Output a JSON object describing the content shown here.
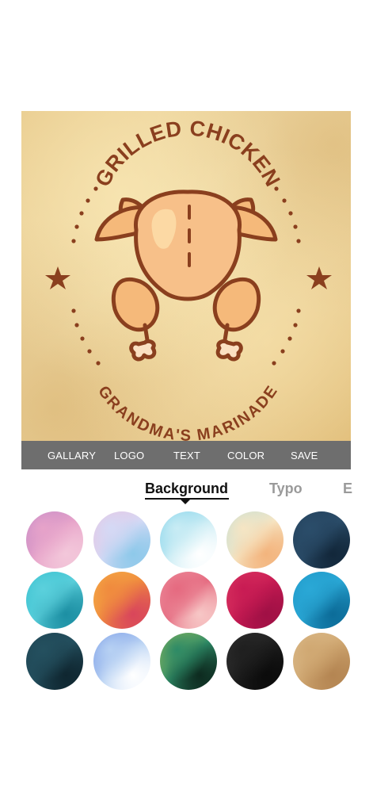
{
  "canvas": {
    "title": "GRILLED CHICKEN",
    "subtitle": "GRANDMA'S MARINADE"
  },
  "toolbar": {
    "items": [
      "GALLARY",
      "LOGO",
      "TEXT",
      "COLOR",
      "SAVE"
    ]
  },
  "tabs": {
    "items": [
      "Background",
      "Typo",
      "E"
    ],
    "active": "Background"
  },
  "colors": {
    "brand_brown": "#8a3f1e",
    "toolbar": "#6e6e6e",
    "chicken_skin": "#f5b97a"
  },
  "swatches": [
    {
      "name": "watercolor-purple-pink",
      "colors": [
        "#b07cc7",
        "#e7a3c9",
        "#f3c7da"
      ]
    },
    {
      "name": "watercolor-pastel-blue",
      "colors": [
        "#f4b9d6",
        "#d4d9f5",
        "#8ec9ea"
      ]
    },
    {
      "name": "watercolor-cyan-white",
      "colors": [
        "#5fc6e6",
        "#c9ecf4",
        "#ffffff"
      ]
    },
    {
      "name": "gradient-peach-teal",
      "colors": [
        "#a9dde1",
        "#f6e5c3",
        "#f3b47d"
      ]
    },
    {
      "name": "grunge-navy",
      "colors": [
        "#1f3a52",
        "#2b4d6a",
        "#12273a"
      ]
    },
    {
      "name": "watercolor-teal",
      "colors": [
        "#22b7c7",
        "#5bd0dc",
        "#1c8fa3"
      ]
    },
    {
      "name": "watercolor-orange-red",
      "colors": [
        "#f6c64a",
        "#f08a3e",
        "#d9465b"
      ]
    },
    {
      "name": "watercolor-pink-stripes",
      "colors": [
        "#f1a4ae",
        "#e56a80",
        "#f7c7c6"
      ]
    },
    {
      "name": "watercolor-crimson",
      "colors": [
        "#e84a6d",
        "#c81b53",
        "#a01045"
      ]
    },
    {
      "name": "texture-ocean-blue",
      "colors": [
        "#1a8fc0",
        "#2aa8d6",
        "#0c6c99"
      ]
    },
    {
      "name": "grunge-dark-teal",
      "colors": [
        "#1b3d4b",
        "#24505f",
        "#0f2630"
      ]
    },
    {
      "name": "watercolor-blue-white",
      "colors": [
        "#5a7fe0",
        "#b7d1f3",
        "#ffffff"
      ]
    },
    {
      "name": "grunge-yellow-green",
      "colors": [
        "#c9d35a",
        "#2d8a66",
        "#0d2a1f"
      ]
    },
    {
      "name": "texture-black",
      "colors": [
        "#3a3a3a",
        "#1f1f1f",
        "#0b0b0b"
      ]
    },
    {
      "name": "parchment-tan",
      "colors": [
        "#e2c69a",
        "#d0a872",
        "#b48552"
      ]
    }
  ]
}
